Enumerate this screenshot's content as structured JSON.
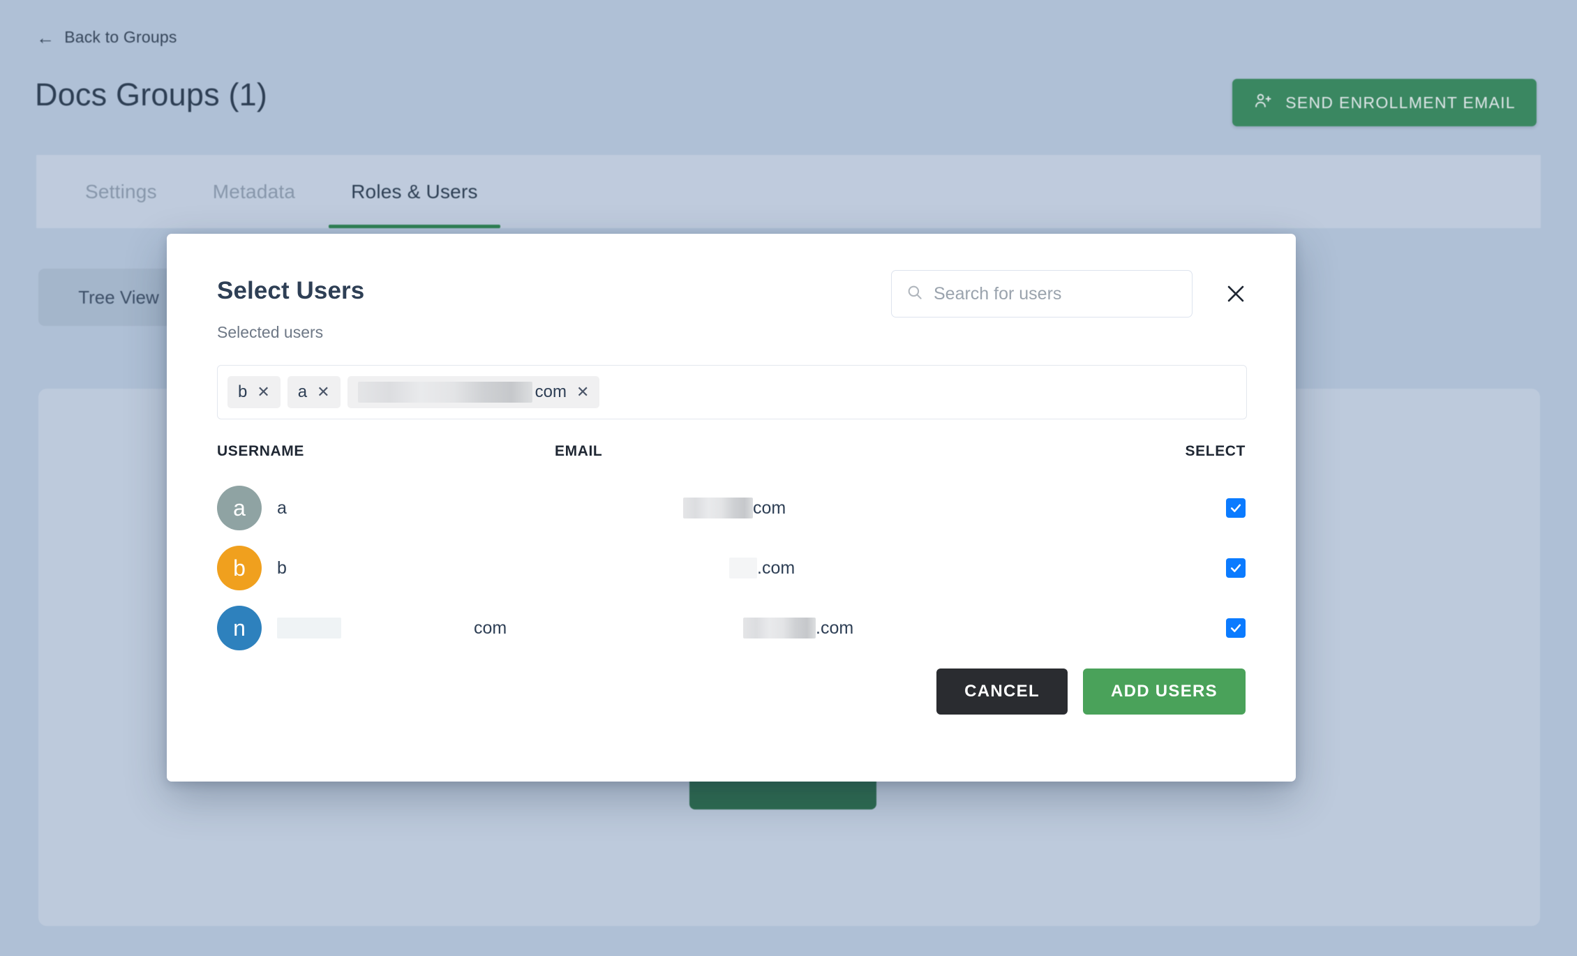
{
  "background": {
    "back_link": {
      "label": "Back to Groups",
      "icon": "arrow-left-icon"
    },
    "page_title": "Docs Groups (1)",
    "enroll_button": {
      "label": "SEND ENROLLMENT EMAIL",
      "icon": "person-add-icon",
      "color": "#3c8b63"
    },
    "tabs": [
      {
        "label": "Settings",
        "active": false
      },
      {
        "label": "Metadata",
        "active": false
      },
      {
        "label": "Roles & Users",
        "active": true
      }
    ],
    "active_tab_underline_color": "#2f8555",
    "tree_view_button": "Tree View"
  },
  "modal": {
    "title": "Select Users",
    "close_icon": "close-icon",
    "search": {
      "icon": "search-icon",
      "placeholder": "Search for users",
      "value": ""
    },
    "selected_users_label": "Selected users",
    "chips": [
      {
        "label": "b",
        "redacted": false,
        "remove_icon": "close-icon"
      },
      {
        "label": "a",
        "redacted": false,
        "remove_icon": "close-icon"
      },
      {
        "label": "com",
        "redacted": true,
        "redacted_width": 250,
        "remove_icon": "close-icon"
      }
    ],
    "table": {
      "columns": [
        "USERNAME",
        "EMAIL",
        "SELECT"
      ],
      "rows": [
        {
          "avatar_letter": "a",
          "avatar_color": "#8fa3a3",
          "username": "a",
          "username_redacted": false,
          "email": "com",
          "email_redacted_width": 100,
          "selected": true
        },
        {
          "avatar_letter": "b",
          "avatar_color": "#f0a01e",
          "username": "b",
          "username_redacted": false,
          "email": ".com",
          "email_redacted_width": 40,
          "selected": true
        },
        {
          "avatar_letter": "n",
          "avatar_color": "#2e81bd",
          "username": "com",
          "username_redacted": true,
          "username_redacted_width": 92,
          "email": ".com",
          "email_redacted_width": 104,
          "selected": true
        }
      ]
    },
    "actions": {
      "cancel_label": "CANCEL",
      "add_label": "ADD USERS",
      "cancel_color": "#2a2c30",
      "add_color": "#4aa25a"
    },
    "checkbox_color": "#0b7bff"
  }
}
